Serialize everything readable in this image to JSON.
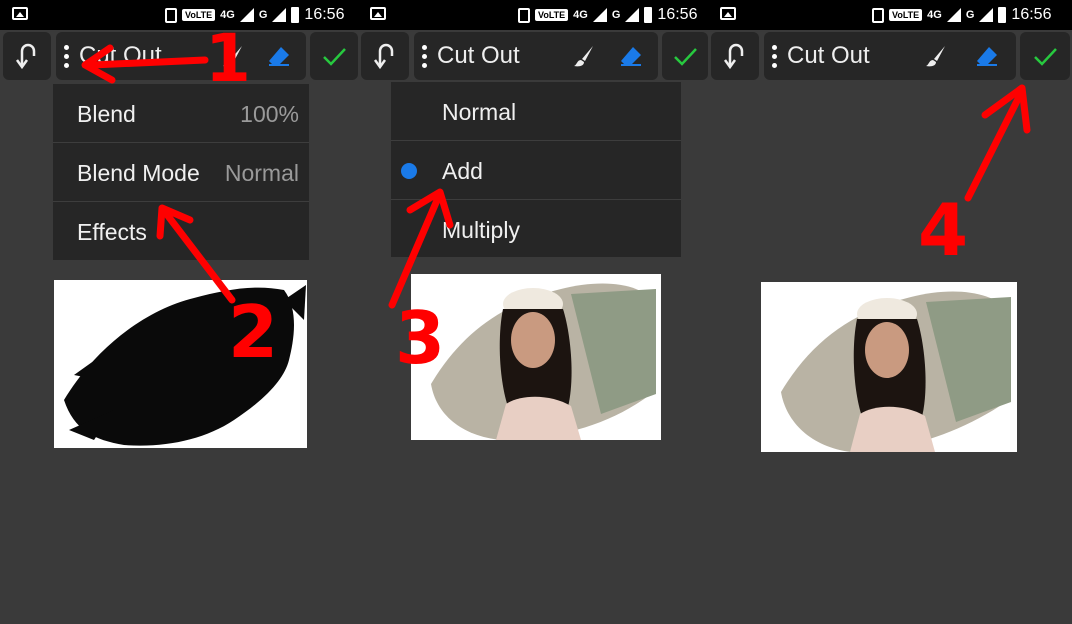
{
  "status_bar": {
    "time": "16:56",
    "volte": "VoLTE",
    "net_4g": "4G",
    "net_g": "G",
    "icons": [
      "gallery-icon",
      "vibrate-icon",
      "signal-icon",
      "battery-icon"
    ]
  },
  "panels": [
    {
      "toolbar": {
        "layer_name": "Cut Out"
      },
      "menu": [
        {
          "label": "Blend",
          "value": "100%"
        },
        {
          "label": "Blend Mode",
          "value": "Normal"
        },
        {
          "label": "Effects",
          "value": ""
        }
      ]
    },
    {
      "toolbar": {
        "layer_name": "Cut Out"
      },
      "blend_modes": [
        {
          "label": "Normal",
          "selected": false
        },
        {
          "label": "Add",
          "selected": true
        },
        {
          "label": "Multiply",
          "selected": false
        }
      ]
    },
    {
      "toolbar": {
        "layer_name": "Cut Out"
      }
    }
  ],
  "annotations": [
    "1",
    "2",
    "3",
    "4"
  ],
  "colors": {
    "accent_blue": "#1a7ae8",
    "check_green": "#27c93f",
    "annotation_red": "#ff0000",
    "background": "#3a3a3a",
    "toolbar": "#262626"
  }
}
